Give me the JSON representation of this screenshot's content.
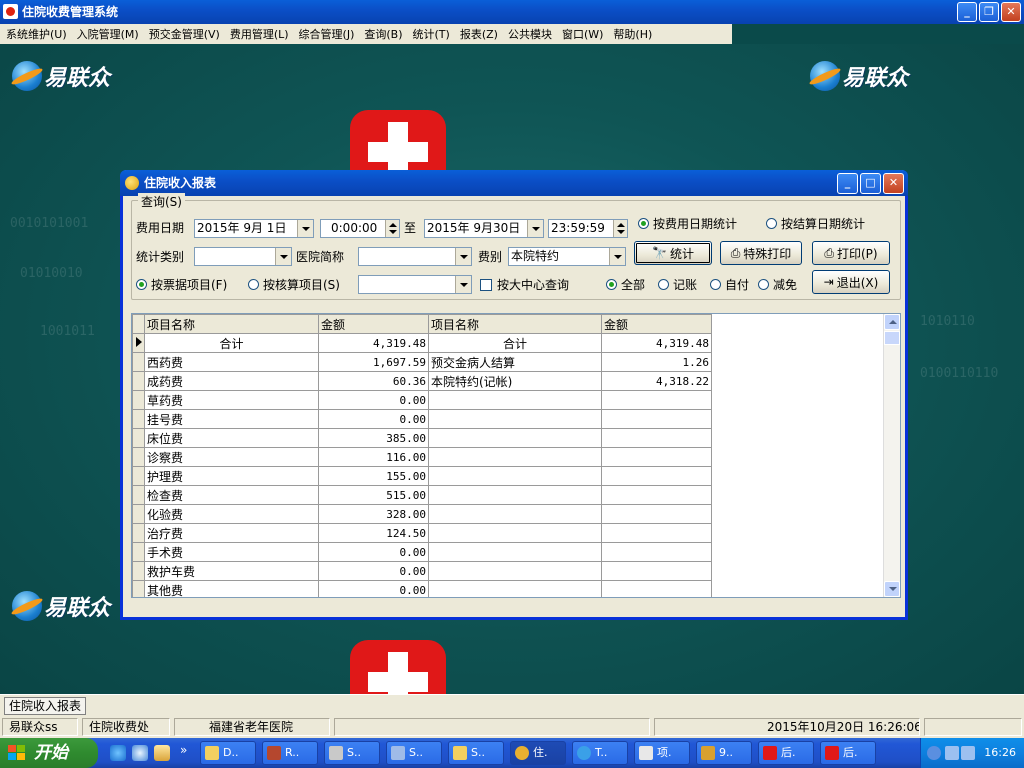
{
  "app": {
    "title": "住院收费管理系统"
  },
  "menu": [
    "系统维护(U)",
    "入院管理(M)",
    "预交金管理(V)",
    "费用管理(L)",
    "综合管理(J)",
    "查询(B)",
    "统计(T)",
    "报表(Z)",
    "公共模块",
    "窗口(W)",
    "帮助(H)"
  ],
  "brand": {
    "logo_text": "易联众"
  },
  "window": {
    "title": "住院收入报表",
    "query_group": "查询(S)",
    "fee_date_label": "费用日期",
    "date_from": "2015年 9月 1日",
    "time_from": "0:00:00",
    "to_label": "至",
    "date_to": "2015年 9月30日",
    "time_to": "23:59:59",
    "radio_by_fee_date": "按费用日期统计",
    "radio_by_settle_date": "按结算日期统计",
    "stat_category_label": "统计类别",
    "stat_category_value": "",
    "hospital_label": "医院简称",
    "hospital_value": "",
    "fee_type_label": "费别",
    "fee_type_value": "本院特约",
    "btn_stat": "统计",
    "btn_special_print": "特殊打印",
    "btn_print": "打印(P)",
    "btn_exit": "退出(X)",
    "radio_by_invoice": "按票据项目(F)",
    "radio_by_audit": "按核算项目(S)",
    "item_select_value": "",
    "check_center": "按大中心查询",
    "radio_all": "全部",
    "radio_account": "记账",
    "radio_self": "自付",
    "radio_exempt": "减免"
  },
  "grid": {
    "headers": [
      "项目名称",
      "金额",
      "项目名称",
      "金额"
    ],
    "rows": [
      [
        "合计",
        "4,319.48",
        "合计",
        "4,319.48"
      ],
      [
        "西药费",
        "1,697.59",
        "预交金病人结算",
        "1.26"
      ],
      [
        "成药费",
        "60.36",
        "本院特约(记帐)",
        "4,318.22"
      ],
      [
        "草药费",
        "0.00",
        "",
        ""
      ],
      [
        "挂号费",
        "0.00",
        "",
        ""
      ],
      [
        "床位费",
        "385.00",
        "",
        ""
      ],
      [
        "诊察费",
        "116.00",
        "",
        ""
      ],
      [
        "护理费",
        "155.00",
        "",
        ""
      ],
      [
        "检查费",
        "515.00",
        "",
        ""
      ],
      [
        "化验费",
        "328.00",
        "",
        ""
      ],
      [
        "治疗费",
        "124.50",
        "",
        ""
      ],
      [
        "手术费",
        "0.00",
        "",
        ""
      ],
      [
        "救护车费",
        "0.00",
        "",
        ""
      ],
      [
        "其他费",
        "0.00",
        "",
        ""
      ]
    ]
  },
  "mdi_tab": "住院收入报表",
  "status": {
    "user": "易联众ss",
    "dept": "住院收费处",
    "hospital": "福建省老年医院",
    "datetime": "2015年10月20日 16:26:06"
  },
  "taskbar": {
    "start": "开始",
    "items": [
      "D..",
      "R..",
      "S..",
      "S..",
      "S..",
      "住.",
      "T..",
      "项.",
      "9..",
      "后.",
      "后."
    ],
    "clock": "16:26"
  },
  "colors": {
    "title_blue": "#0a5fd8",
    "desktop_teal": "#0f5555",
    "cross_red": "#e01818",
    "start_green": "#2f8b2f"
  }
}
